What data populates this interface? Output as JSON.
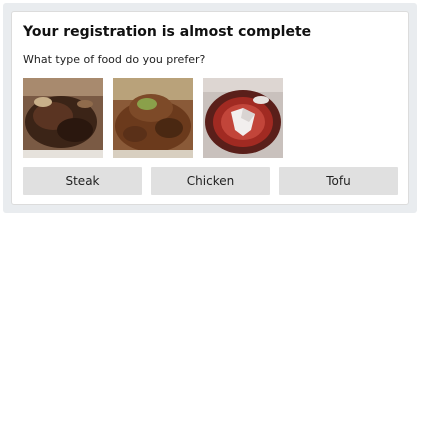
{
  "form": {
    "title": "Your registration is almost complete",
    "question": "What type of food do you prefer?",
    "options": [
      {
        "label": "Steak",
        "image": "steak-photo"
      },
      {
        "label": "Chicken",
        "image": "chicken-photo"
      },
      {
        "label": "Tofu",
        "image": "tofu-photo"
      }
    ]
  }
}
